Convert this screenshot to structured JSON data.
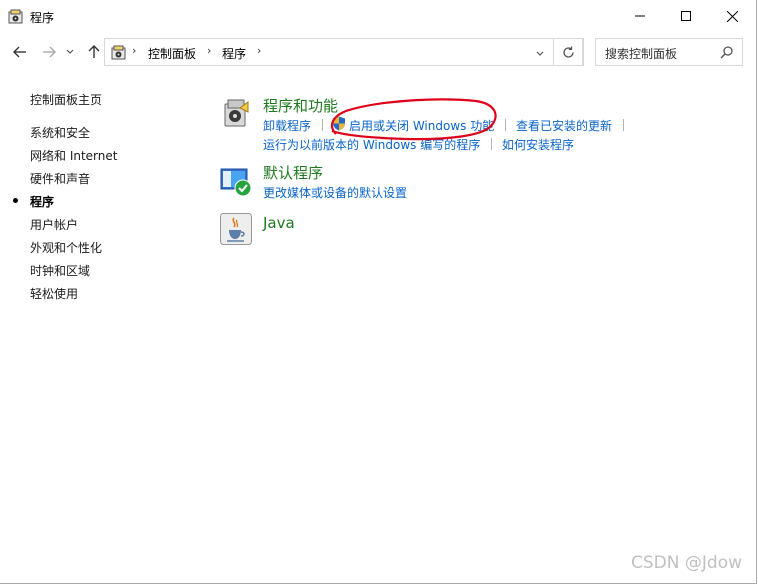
{
  "window": {
    "title": "程序"
  },
  "nav": {
    "breadcrumb": [
      "控制面板",
      "程序"
    ],
    "search_placeholder": "搜索控制面板"
  },
  "sidebar": {
    "items": [
      {
        "label": "控制面板主页",
        "active": false
      },
      {
        "label": "系统和安全",
        "active": false
      },
      {
        "label": "网络和 Internet",
        "active": false
      },
      {
        "label": "硬件和声音",
        "active": false
      },
      {
        "label": "程序",
        "active": true
      },
      {
        "label": "用户帐户",
        "active": false
      },
      {
        "label": "外观和个性化",
        "active": false
      },
      {
        "label": "时钟和区域",
        "active": false
      },
      {
        "label": "轻松使用",
        "active": false
      }
    ]
  },
  "main": {
    "categories": [
      {
        "title": "程序和功能",
        "links": [
          "卸载程序",
          "启用或关闭 Windows 功能",
          "查看已安装的更新",
          "运行为以前版本的 Windows 编写的程序",
          "如何安装程序"
        ]
      },
      {
        "title": "默认程序",
        "links": [
          "更改媒体或设备的默认设置"
        ]
      },
      {
        "title": "Java",
        "links": []
      }
    ]
  },
  "watermark": "CSDN @Jdow",
  "colors": {
    "title_green": "#1e7a1e",
    "link_blue": "#0a64c8",
    "annotation_red": "#e0001a"
  }
}
